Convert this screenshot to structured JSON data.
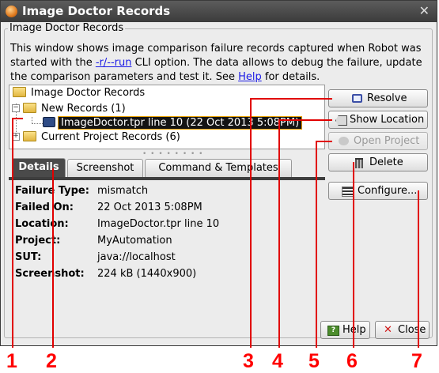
{
  "window": {
    "title": "Image Doctor Records",
    "close_glyph": "✕"
  },
  "group": {
    "legend": "Image Doctor Records"
  },
  "description": {
    "part1": "This window shows image comparison failure records captured when Robot was started with the ",
    "link_run": "-r/--run",
    "part2": " CLI option. The data allows to debug the failure, update the comparison parameters and test it. See ",
    "link_help": "Help",
    "part3": " for details."
  },
  "tree": {
    "root": "Image Doctor Records",
    "new_records": "New Records (1)",
    "selected_record": "ImageDoctor.tpr line 10 (22 Oct 2013 5:08PM)",
    "current_project": "Current Project Records (6)",
    "expander_minus": "−",
    "expander_plus": "+",
    "splitter_dots": "• • • • • • • •"
  },
  "tabs": [
    {
      "label": "Details",
      "active": true
    },
    {
      "label": "Screenshot",
      "active": false
    },
    {
      "label": "Command & Templates",
      "active": false
    }
  ],
  "details": [
    {
      "key": "Failure Type:",
      "value": "mismatch"
    },
    {
      "key": "Failed On:",
      "value": "22 Oct 2013 5:08PM"
    },
    {
      "key": "Location:",
      "value": "ImageDoctor.tpr line 10"
    },
    {
      "key": "Project:",
      "value": "MyAutomation"
    },
    {
      "key": "SUT:",
      "value": "java://localhost"
    },
    {
      "key": "Screenshot:",
      "value": "224 kB (1440x900)"
    }
  ],
  "buttons": {
    "resolve": {
      "label": "Resolve",
      "icon": "magnifier-icon",
      "enabled": true
    },
    "show_location": {
      "label": "Show Location",
      "icon": "tag-icon",
      "enabled": true
    },
    "open_project": {
      "label": "Open Project",
      "icon": "circle-icon",
      "enabled": false
    },
    "delete": {
      "label": "Delete",
      "icon": "trash-icon",
      "enabled": true
    },
    "configure": {
      "label": "Configure...",
      "icon": "settings-list-icon",
      "enabled": true
    },
    "help": {
      "label": "Help",
      "icon": "help-icon",
      "icon_glyph": "?",
      "enabled": true
    },
    "close": {
      "label": "Close",
      "icon": "close-icon",
      "icon_glyph": "✕",
      "enabled": true
    }
  },
  "callouts": [
    "1",
    "2",
    "3",
    "4",
    "5",
    "6",
    "7"
  ],
  "colors": {
    "callout": "#e10000",
    "selection_border": "#e8a000",
    "link": "#1a1ae6"
  }
}
